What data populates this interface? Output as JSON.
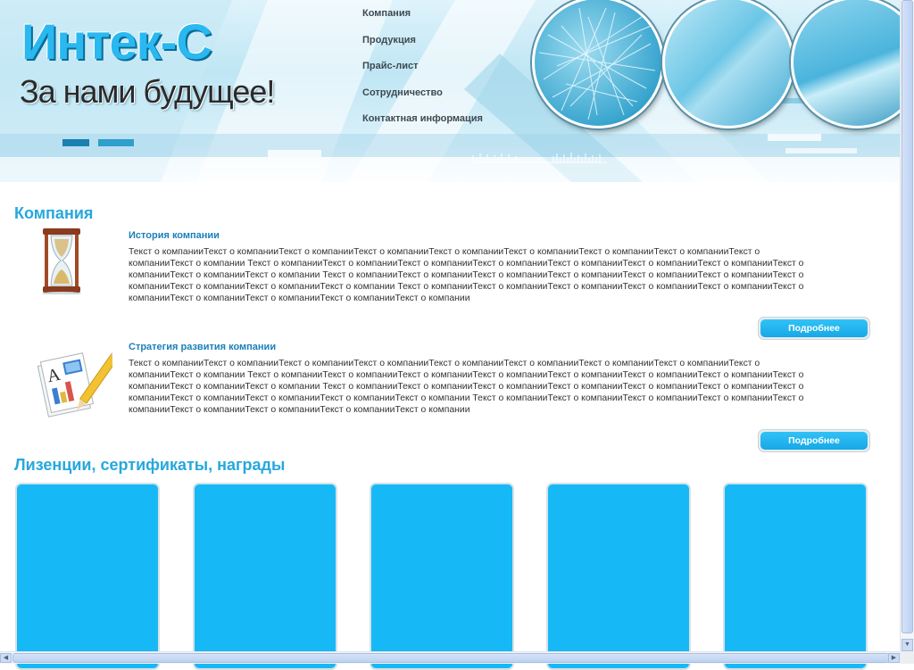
{
  "header": {
    "logo_title": "Интек-С",
    "logo_slogan": "За нами будущее!"
  },
  "nav": {
    "items": [
      {
        "label": "Компания"
      },
      {
        "label": "Продукция"
      },
      {
        "label": "Прайс-лист"
      },
      {
        "label": "Сотрудничество"
      },
      {
        "label": "Контактная информация"
      }
    ]
  },
  "company": {
    "title": "Компания",
    "items": [
      {
        "title": "История компании",
        "lines": [
          "Текст о компанииТекст о компанииТекст о компанииТекст о компанииТекст о компанииТекст о компанииТекст о компанииТекст о компанииТекст о",
          "компанииТекст о компании Текст о компанииТекст о компанииТекст о компанииТекст о компанииТекст о компанииТекст о компанииТекст о компанииТекст о",
          "компанииТекст о компанииТекст о компании Текст о компанииТекст о компанииТекст о компанииТекст о компанииТекст о компанииТекст о компанииТекст о",
          "компанииТекст о компанииТекст о компанииТекст о компании Текст о компанииТекст о компанииТекст о компанииТекст о компанииТекст о компанииТекст о",
          "компанииТекст о компанииТекст о компанииТекст о компанииТекст о компании"
        ],
        "button": "Подробнее"
      },
      {
        "title": "Стратегия развития компании",
        "lines": [
          "Текст о компанииТекст о компанииТекст о компанииТекст о компанииТекст о компанииТекст о компанииТекст о компанииТекст о компанииТекст о",
          "компанииТекст о компании Текст о компанииТекст о компанииТекст о компанииТекст о компанииТекст о компанииТекст о компанииТекст о компанииТекст о",
          "компанииТекст о компанииТекст о компании Текст о компанииТекст о компанииТекст о компанииТекст о компанииТекст о компанииТекст о компанииТекст о",
          "компанииТекст о компанииТекст о компанииТекст о компанииТекст о компании Текст о компанииТекст о компанииТекст о компанииТекст о компанииТекст о",
          "компанииТекст о компанииТекст о компанииТекст о компанииТекст о компании"
        ],
        "button": "Подробнее"
      }
    ]
  },
  "licenses": {
    "title": "Лизенции, сертификаты, награды"
  },
  "colors": {
    "accent": "#26a8dd",
    "card": "#16b9f6",
    "button": "#1fb3ee"
  },
  "icons": {
    "item1": "hourglass-icon",
    "item2": "document-pencil-icon"
  }
}
